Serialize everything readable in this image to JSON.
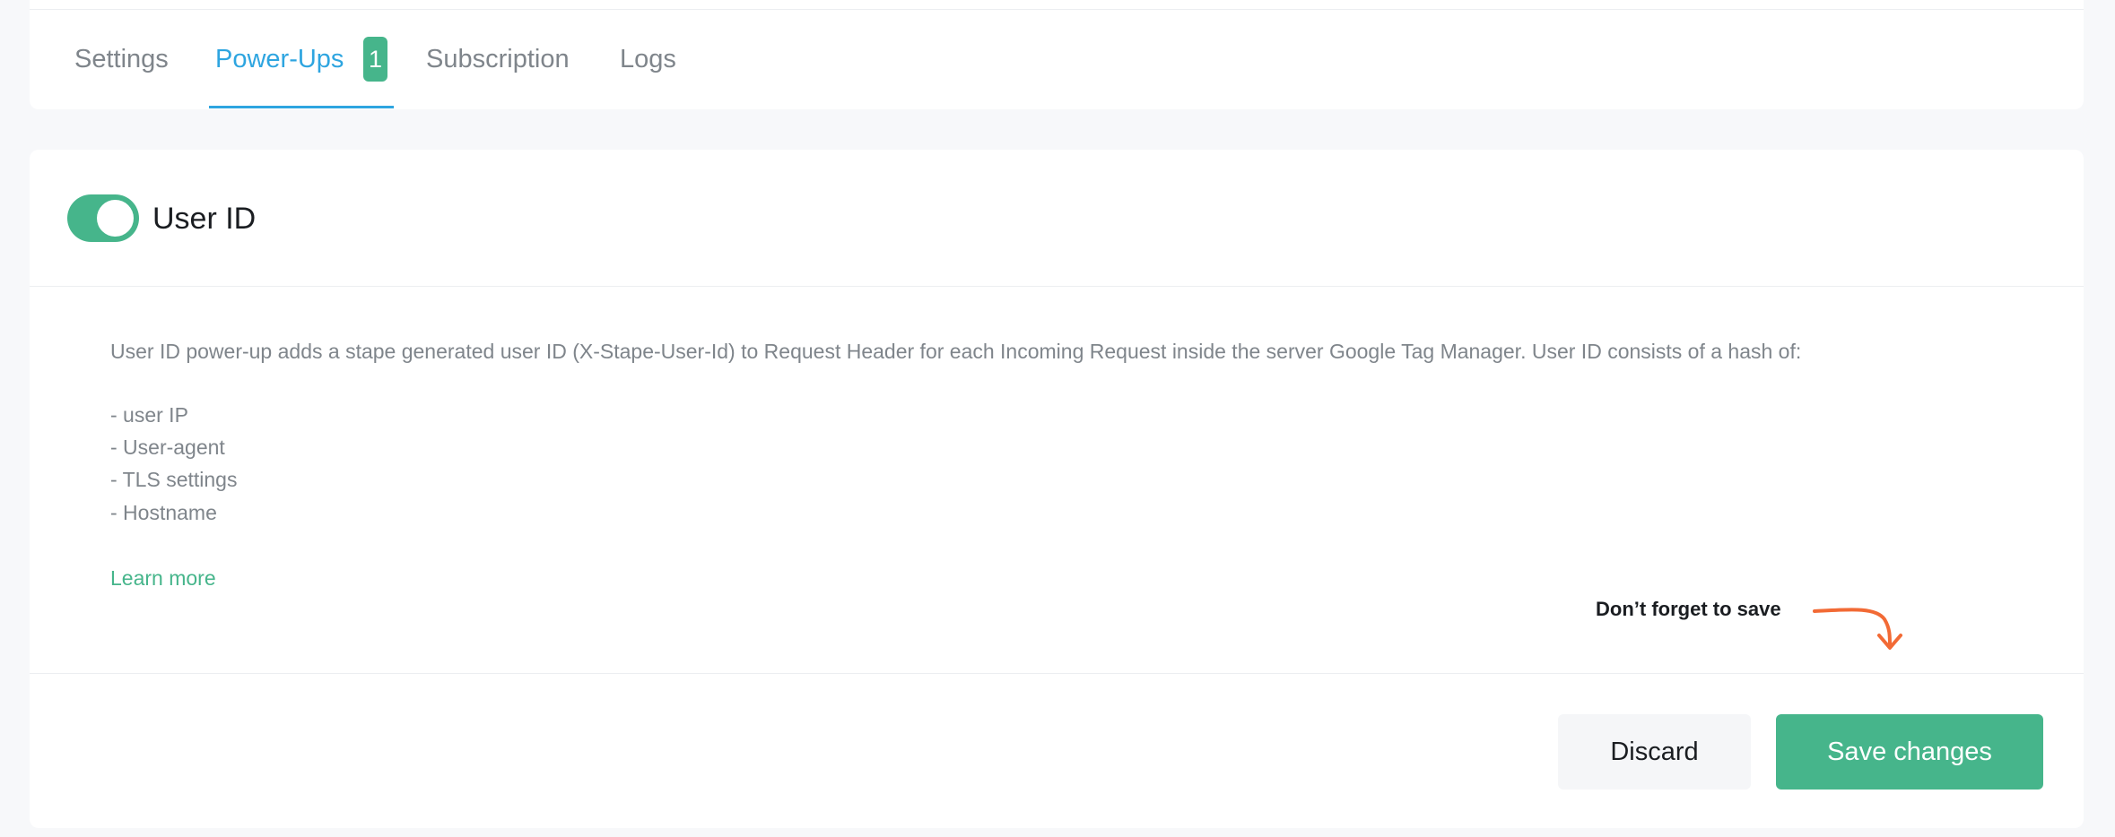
{
  "tabs": [
    {
      "label": "Settings"
    },
    {
      "label": "Power-Ups",
      "active": true,
      "badge": "1"
    },
    {
      "label": "Subscription"
    },
    {
      "label": "Logs"
    }
  ],
  "feature": {
    "title": "User ID",
    "enabled": true,
    "description": "User ID power-up adds a stape generated user ID (X-Stape-User-Id) to Request Header for each Incoming Request inside the server Google Tag Manager. User ID consists of a hash of:",
    "hash_items": [
      "- user IP",
      "- User-agent",
      "- TLS settings",
      "- Hostname"
    ],
    "learn_more": "Learn more"
  },
  "reminder": "Don’t forget to save",
  "actions": {
    "discard_label": "Discard",
    "save_label": "Save changes"
  },
  "colors": {
    "accent_blue": "#2ea5e0",
    "accent_green": "#46b58b",
    "reminder_arrow": "#f26a35"
  }
}
